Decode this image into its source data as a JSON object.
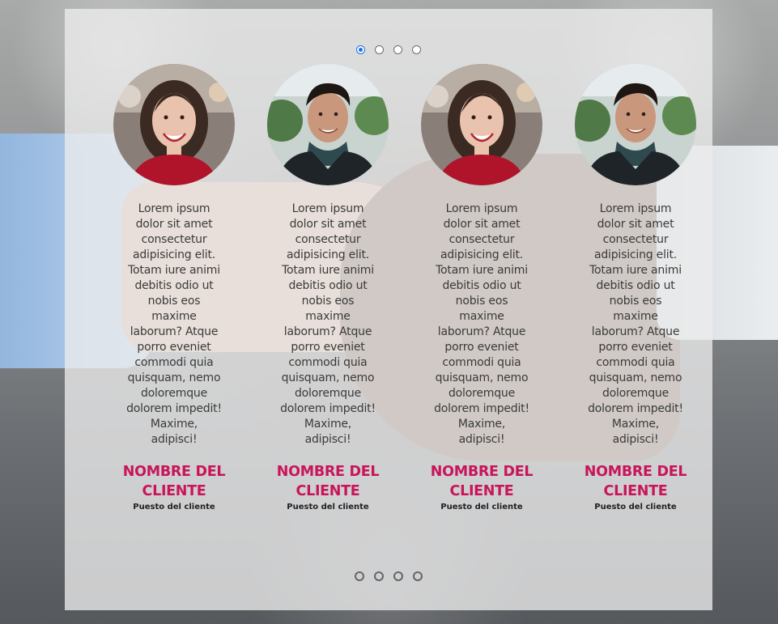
{
  "carousel": {
    "top_indicators": [
      {
        "label": "slide-1",
        "active": true
      },
      {
        "label": "slide-2",
        "active": false
      },
      {
        "label": "slide-3",
        "active": false
      },
      {
        "label": "slide-4",
        "active": false
      }
    ],
    "bottom_indicators": [
      {
        "label": "slide-1"
      },
      {
        "label": "slide-2"
      },
      {
        "label": "slide-3"
      },
      {
        "label": "slide-4"
      }
    ]
  },
  "testimonials": [
    {
      "photo": "woman-smiling-avatar",
      "quote": "Lorem ipsum dolor sit amet consectetur adipisicing elit. Totam iure animi debitis odio ut nobis eos maxime laborum? Atque porro eveniet commodi quia quisquam, nemo doloremque dolorem impedit! Maxime, adipisci!",
      "name": "NOMBRE DEL CLIENTE",
      "role": "Puesto del cliente"
    },
    {
      "photo": "man-smiling-avatar",
      "quote": "Lorem ipsum dolor sit amet consectetur adipisicing elit. Totam iure animi debitis odio ut nobis eos maxime laborum? Atque porro eveniet commodi quia quisquam, nemo doloremque dolorem impedit! Maxime, adipisci!",
      "name": "NOMBRE DEL CLIENTE",
      "role": "Puesto del cliente"
    },
    {
      "photo": "woman-smiling-avatar",
      "quote": "Lorem ipsum dolor sit amet consectetur adipisicing elit. Totam iure animi debitis odio ut nobis eos maxime laborum? Atque porro eveniet commodi quia quisquam, nemo doloremque dolorem impedit! Maxime, adipisci!",
      "name": "NOMBRE DEL CLIENTE",
      "role": "Puesto del cliente"
    },
    {
      "photo": "man-smiling-avatar",
      "quote": "Lorem ipsum dolor sit amet consectetur adipisicing elit. Totam iure animi debitis odio ut nobis eos maxime laborum? Atque porro eveniet commodi quia quisquam, nemo doloremque dolorem impedit! Maxime, adipisci!",
      "name": "NOMBRE DEL CLIENTE",
      "role": "Puesto del cliente"
    }
  ],
  "colors": {
    "name_accent": "#c8155a",
    "active_indicator": "#1a73e8"
  }
}
